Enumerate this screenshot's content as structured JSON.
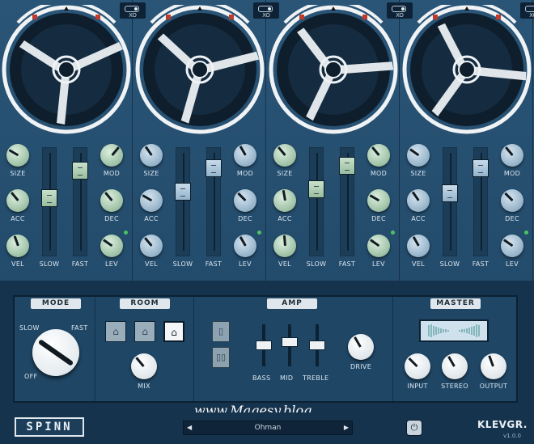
{
  "strips": [
    {
      "xo_label": "XO",
      "theme": "g",
      "labels": {
        "size": "SIZE",
        "acc": "ACC",
        "vel": "VEL",
        "mod": "MOD",
        "dec": "DEC",
        "lev": "LEV",
        "slow": "SLOW",
        "fast": "FAST"
      },
      "slow_level": 0.55,
      "fast_level": 0.85,
      "knobs": {
        "size": -60,
        "acc": -40,
        "vel": -20,
        "mod": 40,
        "dec": -40,
        "lev": -55
      }
    },
    {
      "xo_label": "XO",
      "theme": "b",
      "labels": {
        "size": "SIZE",
        "acc": "ACC",
        "vel": "VEL",
        "mod": "MOD",
        "dec": "DEC",
        "lev": "LEV",
        "slow": "SLOW",
        "fast": "FAST"
      },
      "slow_level": 0.62,
      "fast_level": 0.88,
      "knobs": {
        "size": -35,
        "acc": -60,
        "vel": -40,
        "mod": -30,
        "dec": -45,
        "lev": -30
      }
    },
    {
      "xo_label": "XO",
      "theme": "g",
      "labels": {
        "size": "SIZE",
        "acc": "ACC",
        "vel": "VEL",
        "mod": "MOD",
        "dec": "DEC",
        "lev": "LEV",
        "slow": "SLOW",
        "fast": "FAST"
      },
      "slow_level": 0.65,
      "fast_level": 0.9,
      "knobs": {
        "size": -40,
        "acc": -10,
        "vel": -5,
        "mod": -40,
        "dec": -60,
        "lev": -55
      }
    },
    {
      "xo_label": "XO",
      "theme": "b",
      "labels": {
        "size": "SIZE",
        "acc": "ACC",
        "vel": "VEL",
        "mod": "MOD",
        "dec": "DEC",
        "lev": "LEV",
        "slow": "SLOW",
        "fast": "FAST"
      },
      "slow_level": 0.6,
      "fast_level": 0.88,
      "knobs": {
        "size": -55,
        "acc": -35,
        "vel": -30,
        "mod": -40,
        "dec": -45,
        "lev": -55
      }
    }
  ],
  "mode": {
    "title": "MODE",
    "slow": "SLOW",
    "fast": "FAST",
    "off": "OFF",
    "angle": -55
  },
  "room": {
    "title": "ROOM",
    "mix": "MIX",
    "mix_angle": -40,
    "selected": 2,
    "icons": [
      "house-small-icon",
      "house-medium-icon",
      "house-large-icon"
    ]
  },
  "amp": {
    "title": "AMP",
    "bass": "BASS",
    "mid": "MID",
    "treble": "TREBLE",
    "drive": "DRIVE",
    "drive_angle": -30,
    "bass_level": 0.5,
    "mid_level": 0.6,
    "treble_level": 0.5,
    "icons": [
      "tube-single-icon",
      "tube-double-icon"
    ]
  },
  "master": {
    "title": "MASTER",
    "input": "INPUT",
    "stereo": "STEREO",
    "output": "OUTPUT",
    "input_angle": -45,
    "stereo_angle": -30,
    "output_angle": -20
  },
  "footer": {
    "logo": "SPINN",
    "preset": "Ohman",
    "prev": "◀",
    "next": "▶",
    "brand": "KLEVGR.",
    "version": "v1.0.0",
    "power_icon": "power-icon"
  },
  "watermark": "www.Magesy.blog"
}
